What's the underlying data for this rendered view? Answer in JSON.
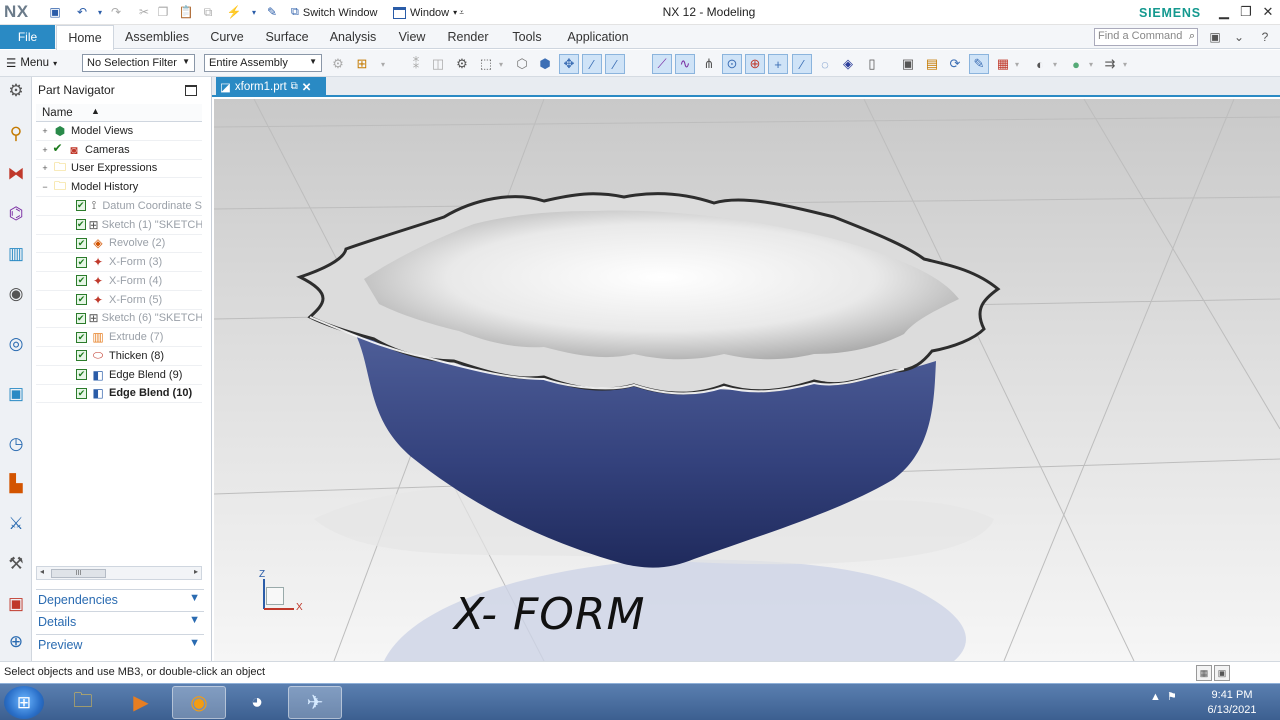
{
  "app": {
    "logo": "NX",
    "title": "NX 12 - Modeling",
    "brand": "SIEMENS",
    "switch_window_label": "Switch Window",
    "window_label": "Window"
  },
  "ribbon": {
    "file_label": "File",
    "tabs": [
      {
        "label": "Home",
        "active": true
      },
      {
        "label": "Assemblies",
        "active": false
      },
      {
        "label": "Curve",
        "active": false
      },
      {
        "label": "Surface",
        "active": false
      },
      {
        "label": "Analysis",
        "active": false
      },
      {
        "label": "View",
        "active": false
      },
      {
        "label": "Render",
        "active": false
      },
      {
        "label": "Tools",
        "active": false
      },
      {
        "label": "Application",
        "active": false
      }
    ],
    "search_placeholder": "Find a Command"
  },
  "toolbar": {
    "menu_label": "Menu",
    "selection_filter": "No Selection Filter",
    "assembly_scope": "Entire Assembly"
  },
  "part_navigator": {
    "title": "Part Navigator",
    "column_name": "Name",
    "items": [
      {
        "label": "Model Views",
        "indent": 0,
        "expander": "+",
        "checked": false
      },
      {
        "label": "Cameras",
        "indent": 0,
        "expander": "+",
        "checked": true
      },
      {
        "label": "User Expressions",
        "indent": 0,
        "expander": "+",
        "checked": false
      },
      {
        "label": "Model History",
        "indent": 0,
        "expander": "−",
        "checked": false
      },
      {
        "label": "Datum Coordinate S",
        "indent": 1,
        "checked": true,
        "state": "suppressed-view"
      },
      {
        "label": "Sketch (1) \"SKETCH",
        "indent": 1,
        "checked": true,
        "state": "suppressed-view"
      },
      {
        "label": "Revolve (2)",
        "indent": 1,
        "checked": true,
        "state": "suppressed-view"
      },
      {
        "label": "X-Form (3)",
        "indent": 1,
        "checked": true,
        "state": "suppressed-view"
      },
      {
        "label": "X-Form (4)",
        "indent": 1,
        "checked": true,
        "state": "suppressed-view"
      },
      {
        "label": "X-Form (5)",
        "indent": 1,
        "checked": true,
        "state": "suppressed-view"
      },
      {
        "label": "Sketch (6) \"SKETCH",
        "indent": 1,
        "checked": true,
        "state": "suppressed-view"
      },
      {
        "label": "Extrude (7)",
        "indent": 1,
        "checked": true,
        "state": "suppressed-view"
      },
      {
        "label": "Thicken (8)",
        "indent": 1,
        "checked": true,
        "state": "normal"
      },
      {
        "label": "Edge Blend (9)",
        "indent": 1,
        "checked": true,
        "state": "normal"
      },
      {
        "label": "Edge Blend (10)",
        "indent": 1,
        "checked": true,
        "state": "current"
      }
    ],
    "scroll_thumb": "III",
    "panels": [
      "Dependencies",
      "Details",
      "Preview"
    ]
  },
  "document": {
    "tab_label": "xform1.prt"
  },
  "viewport": {
    "caption": "X- FORM",
    "triad": {
      "z": "Z",
      "x": "X"
    },
    "colors": {
      "bowl_outer": "#2e3c78",
      "bowl_inner": "#f2f2f2"
    }
  },
  "status": {
    "message": "Select objects and use MB3, or double-click an object"
  },
  "taskbar": {
    "time": "9:41 PM",
    "date": "6/13/2021"
  }
}
